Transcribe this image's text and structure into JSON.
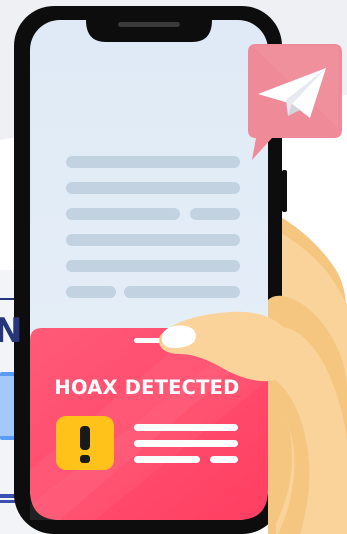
{
  "alert": {
    "title": "HOAX DETECTED",
    "icon": "exclamation-warning-icon"
  },
  "background": {
    "partial_letter": "N"
  },
  "send_badge": {
    "icon": "paper-plane-icon"
  },
  "colors": {
    "phone_frame": "#0d0d0d",
    "screen": "#e3ecf6",
    "placeholder_line": "#c3d2e0",
    "alert_card": "#ff4d6d",
    "warning_badge": "#ffc21a",
    "send_badge": "#ef8a98",
    "hand_skin": "#f9d39a"
  }
}
